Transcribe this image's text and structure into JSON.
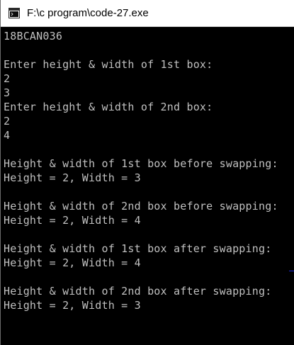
{
  "window": {
    "title": "F:\\c program\\code-27.exe"
  },
  "icons": {
    "title_icon": "console-app-icon"
  },
  "colors": {
    "console_background": "#000000",
    "console_text": "#c0c0c0",
    "titlebar_background": "#ffffff"
  },
  "console": {
    "lines": [
      "18BCAN036",
      "",
      "Enter height & width of 1st box:",
      "2",
      "3",
      "Enter height & width of 2nd box:",
      "2",
      "4",
      "",
      "Height & width of 1st box before swapping:",
      "Height = 2, Width = 3",
      "",
      "Height & width of 2nd box before swapping:",
      "Height = 2, Width = 4",
      "",
      "Height & width of 1st box after swapping:",
      "Height = 2, Width = 4",
      "",
      "Height & width of 2nd box after swapping:",
      "Height = 2, Width = 3"
    ]
  }
}
